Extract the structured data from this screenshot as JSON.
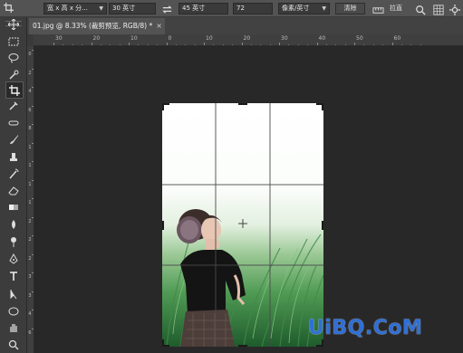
{
  "options_bar": {
    "crop_tool_icon": "crop-icon",
    "ratio_preset": "宽 x 高 x 分...",
    "width_value": "30 英寸",
    "swap_icon": "swap-arrows-icon",
    "height_value": "45 英寸",
    "resolution_value": "72",
    "resolution_unit": "像素/英寸",
    "clear_label": "清除",
    "straighten_label": "拉直"
  },
  "document_tab": {
    "title": "01.jpg @ 8.33% (裁剪预览, RGB/8) *"
  },
  "ruler": {
    "h_labels": [
      "30",
      "20",
      "10",
      "0",
      "10",
      "20",
      "30",
      "40",
      "50",
      "60"
    ],
    "v_labels": [
      "0",
      "2",
      "4",
      "6",
      "8",
      "1",
      "1",
      "1",
      "1",
      "2",
      "2",
      "2",
      "3",
      "3",
      "4",
      "6"
    ]
  },
  "toolbox": {
    "tools": [
      "move-icon",
      "marquee-icon",
      "lasso-icon",
      "quick-select-icon",
      "crop-icon",
      "eyedropper-icon",
      "healing-icon",
      "brush-icon",
      "stamp-icon",
      "history-brush-icon",
      "eraser-icon",
      "gradient-icon",
      "blur-icon",
      "dodge-icon",
      "pen-icon",
      "type-icon",
      "path-select-icon",
      "shape-icon",
      "hand-icon",
      "zoom-icon"
    ]
  },
  "watermark": "UiBQ.CoM",
  "colors": {
    "chrome": "#535353",
    "canvas_bg": "#282828",
    "watermark": "#2f6fd6"
  }
}
